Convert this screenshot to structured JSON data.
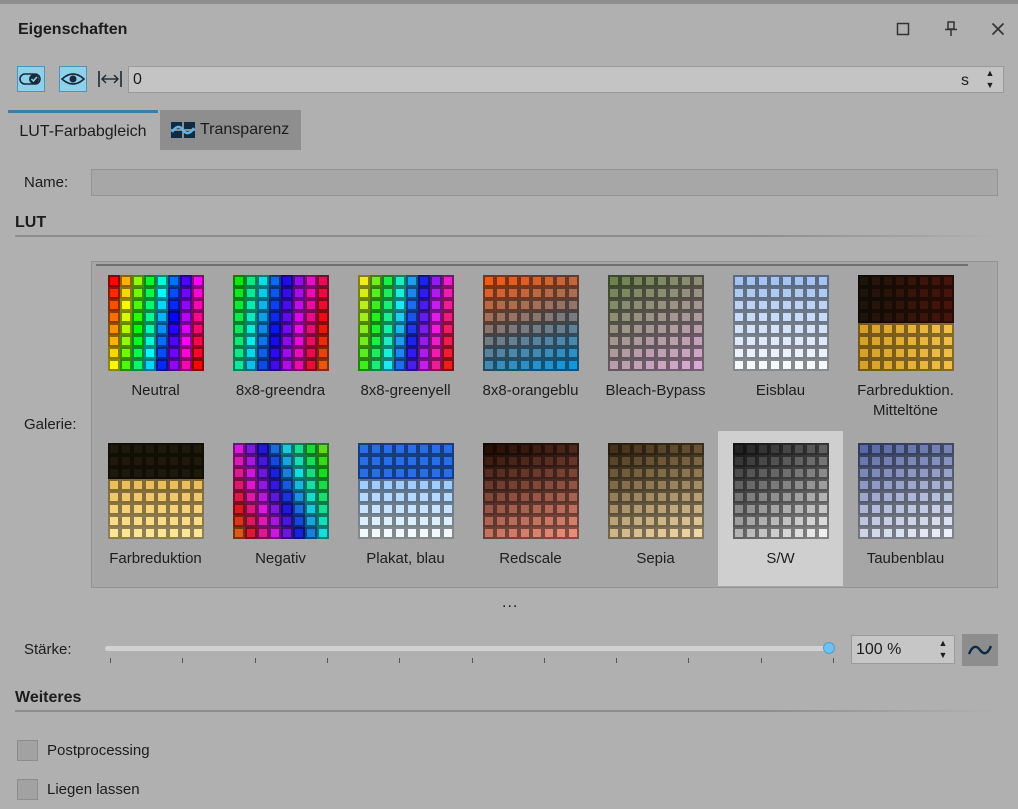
{
  "panel": {
    "title": "Eigenschaften"
  },
  "toolbar": {
    "time_value": "0",
    "time_unit": "s"
  },
  "tabs": [
    {
      "label": "LUT-Farbabgleich",
      "active": true
    },
    {
      "label": "Transparenz",
      "active": false
    }
  ],
  "name_row": {
    "label": "Name:",
    "value": ""
  },
  "lut_section": {
    "title": "LUT",
    "gallery_label": "Galerie:",
    "more": "..."
  },
  "gallery": [
    {
      "label": "Neutral",
      "palette": "neutral"
    },
    {
      "label": "8x8-greendra",
      "palette": "greendra"
    },
    {
      "label": "8x8-greenyell",
      "palette": "greenyell"
    },
    {
      "label": "8x8-orangeblu",
      "palette": "orangeblu"
    },
    {
      "label": "Bleach-Bypass",
      "palette": "bleach"
    },
    {
      "label": "Eisblau",
      "palette": "eisblau"
    },
    {
      "label": "Farbreduktion. Mitteltöne",
      "palette": "farbmittel"
    },
    {
      "label": "Farbreduktion",
      "palette": "farb"
    },
    {
      "label": "Negativ",
      "palette": "negativ"
    },
    {
      "label": "Plakat, blau",
      "palette": "plakat"
    },
    {
      "label": "Redscale",
      "palette": "redscale"
    },
    {
      "label": "Sepia",
      "palette": "sepia"
    },
    {
      "label": "S/W",
      "palette": "sw",
      "selected": true
    },
    {
      "label": "Taubenblau",
      "palette": "taubenblau"
    }
  ],
  "strength": {
    "label": "Stärke:",
    "value": "100 %",
    "level": 1.0
  },
  "weiteres": {
    "title": "Weiteres",
    "options": [
      {
        "label": "Postprocessing",
        "checked": false
      },
      {
        "label": "Liegen lassen",
        "checked": false
      }
    ]
  }
}
